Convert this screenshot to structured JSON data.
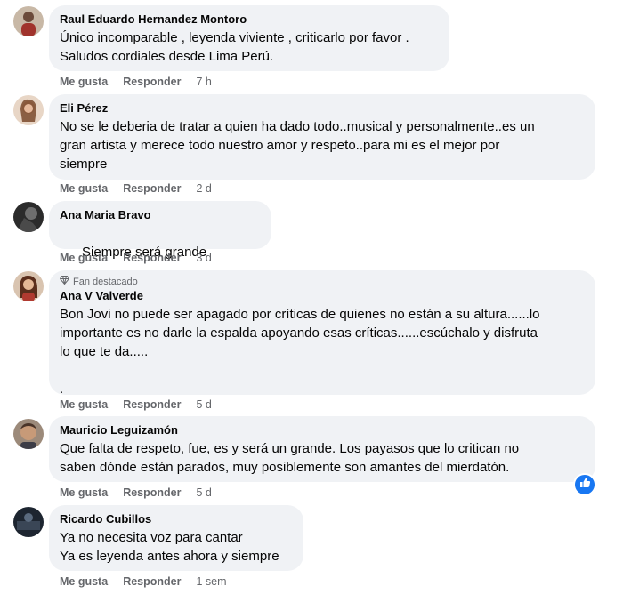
{
  "comments": [
    {
      "author": "Raul Eduardo Hernandez Montoro",
      "text": "Único incomparable , leyenda viviente , criticarlo por favor .\nSaludos cordiales desde Lima Perú.",
      "like": "Me gusta",
      "reply": "Responder",
      "time": "7 h"
    },
    {
      "author": "Eli Pérez",
      "text": "No se le deberia de tratar a quien ha dado todo..musical y personalmente..es un\ngran artista y merece todo nuestro amor y respeto..para mi es el mejor por\nsiempre",
      "like": "Me gusta",
      "reply": "Responder",
      "time": "2 d"
    },
    {
      "author": "Ana Maria Bravo",
      "text": "Siempre será grande",
      "emojis": [
        "rock-hand-emoji",
        "flexed-biceps-emoji",
        "flexed-biceps-emoji",
        "flexed-biceps-emoji"
      ],
      "like": "Me gusta",
      "reply": "Responder",
      "time": "3 d"
    },
    {
      "badge": "Fan destacado",
      "author": "Ana V Valverde",
      "text": "Bon Jovi no puede ser apagado por críticas de quienes no están a su altura......lo\nimportante es no darle la espalda apoyando esas críticas......escúchalo y disfruta\nlo que te da.....\n\n.",
      "like": "Me gusta",
      "reply": "Responder",
      "time": "5 d"
    },
    {
      "author": "Mauricio Leguizamón",
      "text": "Que falta de respeto, fue, es y será un grande. Los payasos que lo critican no\nsaben dónde están parados, muy posiblemente son amantes del mierdatón.",
      "like": "Me gusta",
      "reply": "Responder",
      "time": "5 d"
    },
    {
      "author": "Ricardo Cubillos",
      "text": "Ya no necesita voz para cantar\nYa es leyenda antes ahora y siempre",
      "like": "Me gusta",
      "reply": "Responder",
      "time": "1 sem"
    }
  ],
  "colors": {
    "bubble": "#f0f2f5",
    "meta": "#65676b",
    "like_blue": "#1877f2"
  }
}
